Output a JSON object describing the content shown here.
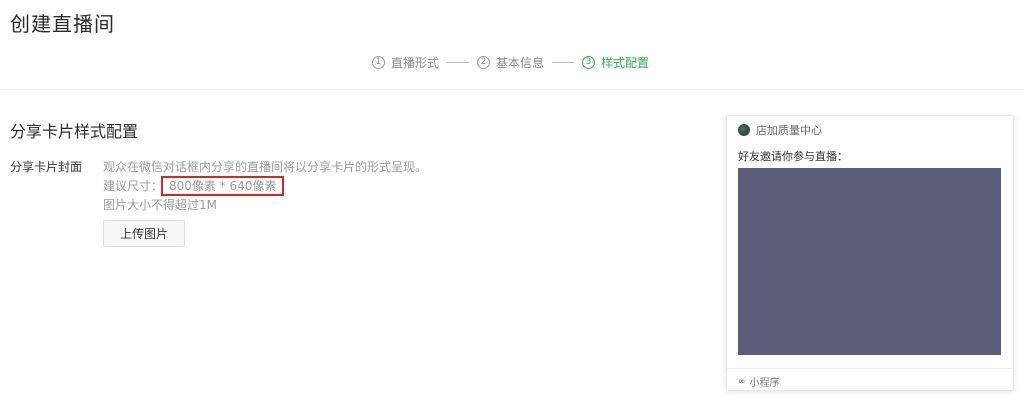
{
  "page": {
    "title": "创建直播间"
  },
  "steps": [
    {
      "number": "1",
      "label": "直播形式",
      "active": false
    },
    {
      "number": "2",
      "label": "基本信息",
      "active": false
    },
    {
      "number": "3",
      "label": "样式配置",
      "active": true
    }
  ],
  "section": {
    "title": "分享卡片样式配置"
  },
  "cover": {
    "label": "分享卡片封面",
    "description": "观众在微信对话框内分享的直播间将以分享卡片的形式呈现。",
    "size_prefix": "建议尺寸：",
    "size_value": "800像素 * 640像素",
    "size_limit": "图片大小不得超过1M",
    "upload_label": "上传图片"
  },
  "preview": {
    "shop_name": "店加质量中心",
    "invite_text": "好友邀请你参与直播：",
    "footer_label": "小程序",
    "cover_color": "#5c5e7a"
  },
  "colors": {
    "accent": "#2bb24c",
    "highlight": "#d22a20"
  }
}
